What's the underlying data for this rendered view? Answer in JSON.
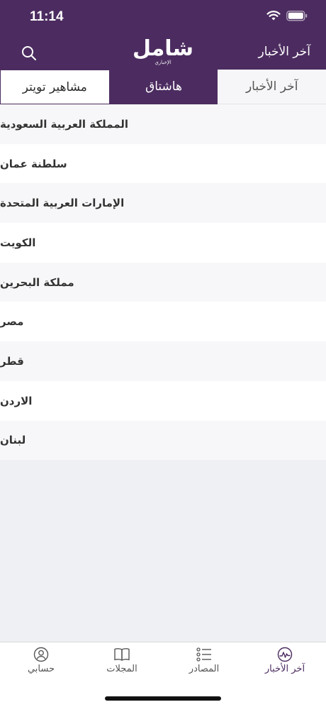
{
  "status_bar": {
    "time": "11:14"
  },
  "nav": {
    "title": "آخر الأخبار",
    "logo_main": "شامل",
    "logo_sub": "الإخباري"
  },
  "tabs": [
    {
      "label": "مشاهير تويتر"
    },
    {
      "label": "هاشتاق"
    },
    {
      "label": "آخر الأخبار"
    }
  ],
  "countries": [
    "المملكة العربية السعودية",
    "سلطنة عمان",
    "الإمارات العربية المتحدة",
    "الكويت",
    "مملكة البحرين",
    "مصر",
    "قطر",
    "الاردن",
    "لبنان"
  ],
  "tabbar": {
    "account": "حسابي",
    "magazines": "المجلات",
    "sources": "المصادر",
    "latest": "آخر الأخبار"
  },
  "colors": {
    "brand": "#4c2c60"
  }
}
